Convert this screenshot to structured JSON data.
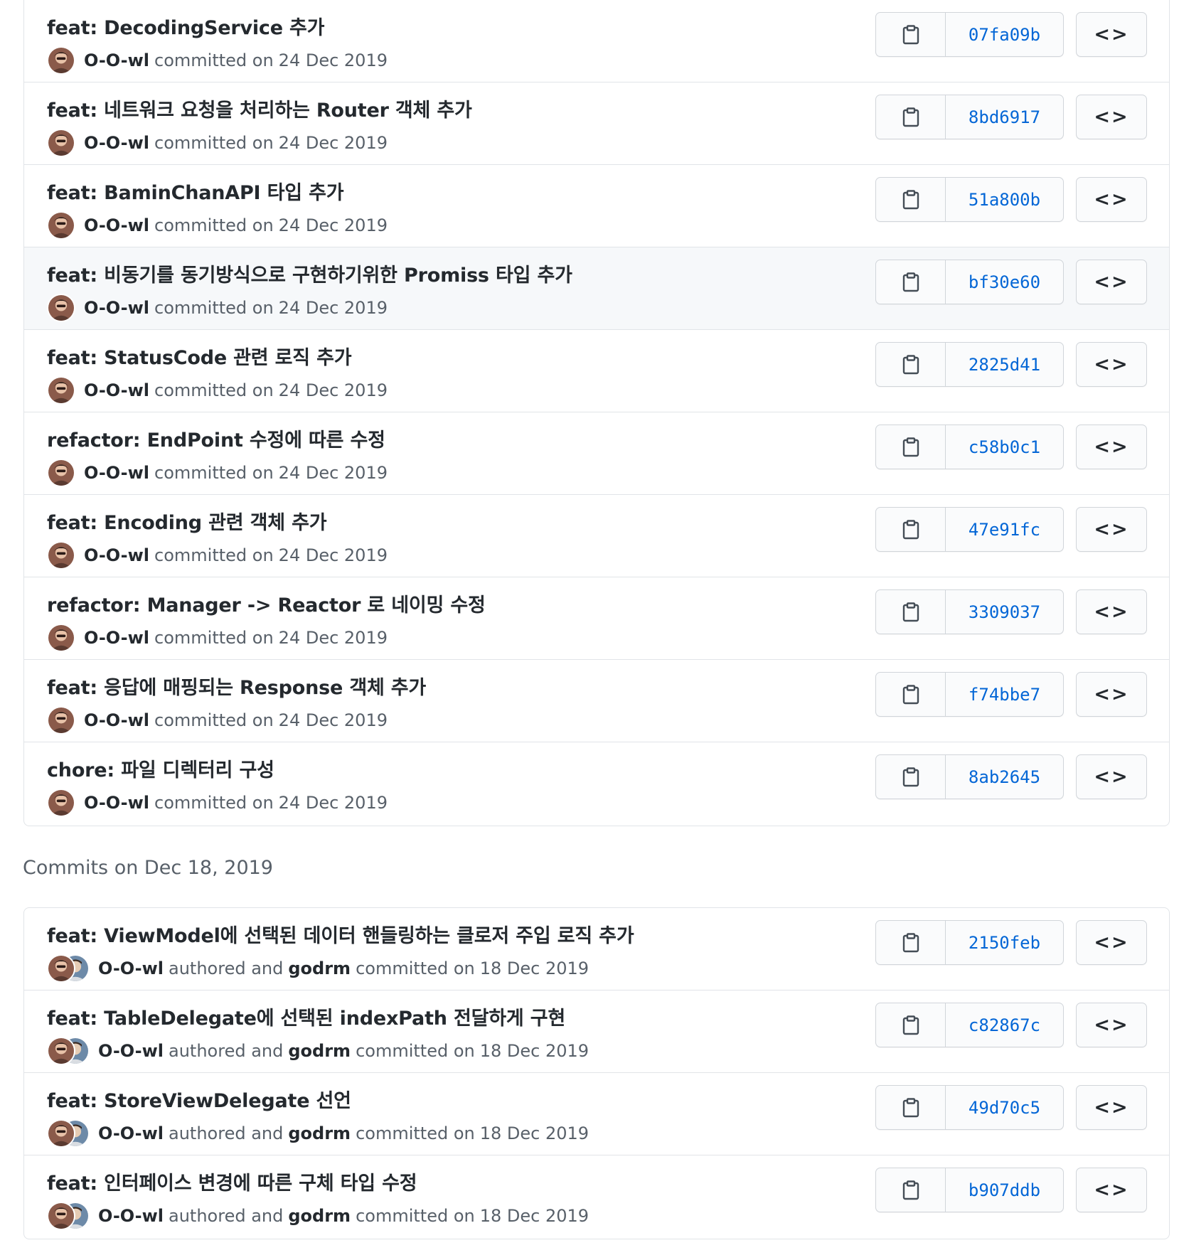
{
  "groups": [
    {
      "commits": [
        {
          "message": "feat: DecodingService 추가",
          "author": "O-O-wl",
          "verb": "committed on",
          "date": "24 Dec 2019",
          "sha": "07fa09b"
        },
        {
          "message": "feat: 네트워크 요청을 처리하는 Router 객체 추가",
          "author": "O-O-wl",
          "verb": "committed on",
          "date": "24 Dec 2019",
          "sha": "8bd6917"
        },
        {
          "message": "feat: BaminChanAPI 타입 추가",
          "author": "O-O-wl",
          "verb": "committed on",
          "date": "24 Dec 2019",
          "sha": "51a800b"
        },
        {
          "message": "feat: 비동기를 동기방식으로 구현하기위한 Promiss 타입 추가",
          "author": "O-O-wl",
          "verb": "committed on",
          "date": "24 Dec 2019",
          "sha": "bf30e60"
        },
        {
          "message": "feat: StatusCode 관련 로직 추가",
          "author": "O-O-wl",
          "verb": "committed on",
          "date": "24 Dec 2019",
          "sha": "2825d41"
        },
        {
          "message": "refactor: EndPoint 수정에 따른 수정",
          "author": "O-O-wl",
          "verb": "committed on",
          "date": "24 Dec 2019",
          "sha": "c58b0c1"
        },
        {
          "message": "feat: Encoding 관련 객체 추가",
          "author": "O-O-wl",
          "verb": "committed on",
          "date": "24 Dec 2019",
          "sha": "47e91fc"
        },
        {
          "message": "refactor: Manager -> Reactor 로 네이밍 수정",
          "author": "O-O-wl",
          "verb": "committed on",
          "date": "24 Dec 2019",
          "sha": "3309037"
        },
        {
          "message": "feat: 응답에 매핑되는 Response 객체 추가",
          "author": "O-O-wl",
          "verb": "committed on",
          "date": "24 Dec 2019",
          "sha": "f74bbe7"
        },
        {
          "message": "chore: 파일 디렉터리 구성",
          "author": "O-O-wl",
          "verb": "committed on",
          "date": "24 Dec 2019",
          "sha": "8ab2645"
        }
      ]
    },
    {
      "header": "Commits on Dec 18, 2019",
      "commits": [
        {
          "message": "feat: ViewModel에 선택된 데이터 핸들링하는 클로저 주입 로직 추가",
          "author": "O-O-wl",
          "authored": "authored and",
          "committer": "godrm",
          "verb": "committed on",
          "date": "18 Dec 2019",
          "sha": "2150feb"
        },
        {
          "message": "feat: TableDelegate에 선택된 indexPath 전달하게 구현",
          "author": "O-O-wl",
          "authored": "authored and",
          "committer": "godrm",
          "verb": "committed on",
          "date": "18 Dec 2019",
          "sha": "c82867c"
        },
        {
          "message": "feat: StoreViewDelegate 선언",
          "author": "O-O-wl",
          "authored": "authored and",
          "committer": "godrm",
          "verb": "committed on",
          "date": "18 Dec 2019",
          "sha": "49d70c5"
        },
        {
          "message": "feat: 인터페이스 변경에 따른 구체 타입 수정",
          "author": "O-O-wl",
          "authored": "authored and",
          "committer": "godrm",
          "verb": "committed on",
          "date": "18 Dec 2019",
          "sha": "b907ddb"
        }
      ]
    }
  ],
  "browse_label": "<>",
  "icons": {
    "copy": "clipboard-icon",
    "browse": "code-icon"
  },
  "colors": {
    "sha": "#0366d6",
    "border": "#e1e4e8",
    "highlight_row": "#f6f8fa",
    "muted": "#586069"
  }
}
